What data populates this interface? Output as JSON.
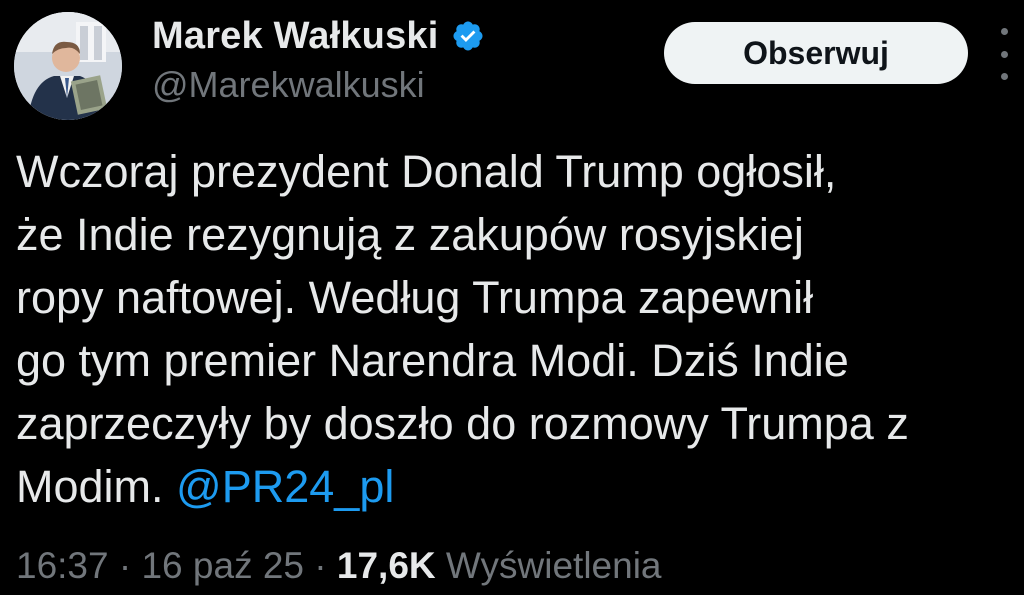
{
  "author": {
    "display_name": "Marek Wałkuski",
    "handle": "@Marekwalkuski",
    "verified_icon": "verified-badge-icon",
    "verified_color": "#1d9bf0"
  },
  "actions": {
    "follow_label": "Obserwuj",
    "more_icon": "more-vertical-icon"
  },
  "tweet": {
    "lines": [
      "Wczoraj prezydent Donald Trump ogłosił,",
      "że Indie rezygnują z zakupów rosyjskiej",
      "ropy naftowej. Według Trumpa zapewnił",
      "go tym premier Narendra Modi. Dziś Indie",
      "zaprzeczyły by doszło do rozmowy Trumpa z"
    ],
    "last_line_text": "Modim.",
    "mention": "@PR24_pl",
    "mention_color": "#1d9bf0"
  },
  "meta": {
    "time": "16:37",
    "separator": "·",
    "date": "16 paź 25",
    "views_count": "17,6K",
    "views_label": "Wyświetlenia"
  }
}
